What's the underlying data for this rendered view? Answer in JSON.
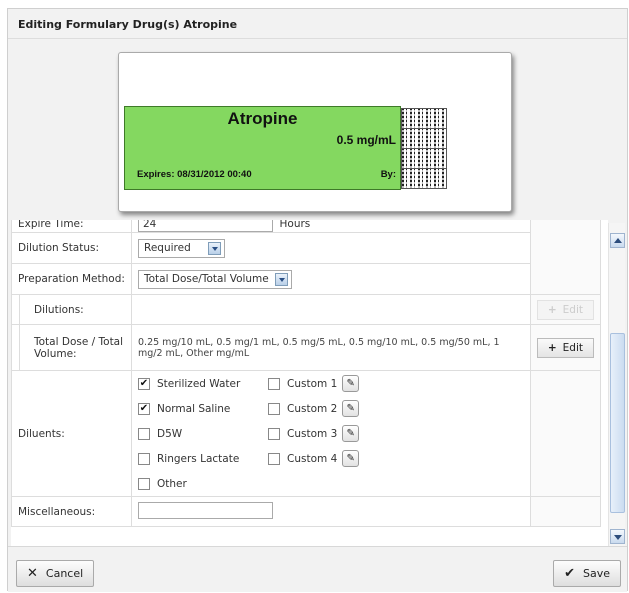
{
  "dialog": {
    "title": "Editing Formulary Drug(s) Atropine"
  },
  "label_preview": {
    "drug_name": "Atropine",
    "dose": "0.5 mg/mL",
    "expires": "Expires: 08/31/2012 00:40",
    "by": "By:",
    "label_color": "#84d860"
  },
  "form": {
    "expire_time": {
      "label": "Expire Time:",
      "value": "24",
      "unit": "Hours"
    },
    "dilution_status": {
      "label": "Dilution Status:",
      "value": "Required"
    },
    "preparation_method": {
      "label": "Preparation Method:",
      "value": "Total Dose/Total Volume"
    },
    "dilutions": {
      "label": "Dilutions:",
      "edit_label": "Edit"
    },
    "total_dose": {
      "label": "Total Dose / Total Volume:",
      "value": "0.25 mg/10 mL, 0.5 mg/1 mL, 0.5 mg/5 mL, 0.5 mg/10 mL, 0.5 mg/50 mL, 1 mg/2 mL, Other mg/mL",
      "edit_label": "Edit"
    },
    "diluents": {
      "label": "Diluents:",
      "options": [
        {
          "label": "Sterilized Water",
          "checked": true
        },
        {
          "label": "Custom 1",
          "checked": false
        },
        {
          "label": "Normal Saline",
          "checked": true
        },
        {
          "label": "Custom 2",
          "checked": false
        },
        {
          "label": "D5W",
          "checked": false
        },
        {
          "label": "Custom 3",
          "checked": false
        },
        {
          "label": "Ringers Lactate",
          "checked": false
        },
        {
          "label": "Custom 4",
          "checked": false
        },
        {
          "label": "Other",
          "checked": false
        }
      ]
    },
    "miscellaneous": {
      "label": "Miscellaneous:",
      "value": ""
    }
  },
  "footer": {
    "cancel_label": "Cancel",
    "save_label": "Save"
  }
}
